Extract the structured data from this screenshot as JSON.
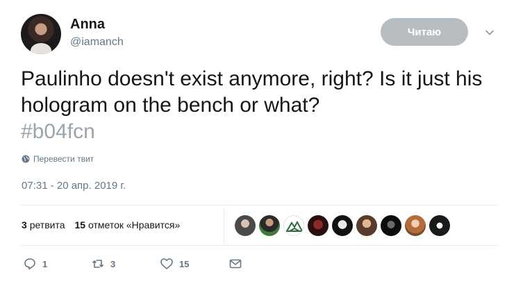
{
  "author": {
    "name": "Anna",
    "handle": "@iamanch"
  },
  "follow_button": {
    "label": "Читаю",
    "color": "#b8bdc2"
  },
  "tweet": {
    "text": "Paulinho doesn't exist anymore, right? Is it just his hologram on the bench or what?",
    "hashtag": "#b04fcn",
    "translate_label": "Перевести твит",
    "timestamp": "07:31 - 20 апр. 2019 г."
  },
  "stats": {
    "retweets_count": "3",
    "retweets_label": "ретвита",
    "likes_count": "15",
    "likes_label": "отметок «Нравится»"
  },
  "actions": {
    "reply_count": "1",
    "retweet_count": "3",
    "like_count": "15"
  },
  "icons": [
    "globe-icon",
    "chevron-down-icon",
    "reply-icon",
    "retweet-icon",
    "heart-icon",
    "message-icon"
  ],
  "colors": {
    "secondary_text": "#657786",
    "hashtag": "#9aa4ad",
    "divider": "#e6ecf0"
  }
}
